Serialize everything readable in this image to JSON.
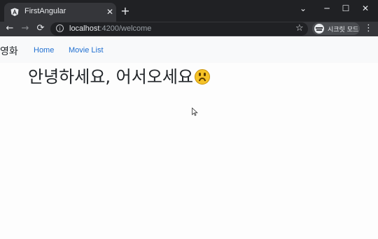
{
  "browser": {
    "tab": {
      "title": "FirstAngular",
      "favicon": "angular-icon",
      "close_glyph": "✕"
    },
    "new_tab_glyph": "+",
    "window_controls": {
      "chevron": "⌄",
      "minimize": "─",
      "maximize": "☐",
      "close": "✕"
    },
    "nav": {
      "back": "←",
      "forward": "→",
      "reload": "⟳"
    },
    "address": {
      "host": "localhost",
      "rest": ":4200/welcome",
      "info_glyph": "i"
    },
    "bookmark_glyph": "☆",
    "incognito_label": "시크릿 모드",
    "menu_glyph": "⋮"
  },
  "app": {
    "brand": "영화",
    "nav_links": [
      "Home",
      "Movie List"
    ],
    "welcome_text": "안녕하세요, 어서오세요",
    "emoji": "upside-down-face-icon"
  },
  "colors": {
    "tabstrip_bg": "#202124",
    "toolbar_bg": "#35363a",
    "navbar_bg": "#f8f9fa",
    "link": "#1f6fd1",
    "emoji_yellow": "#f5c227"
  }
}
